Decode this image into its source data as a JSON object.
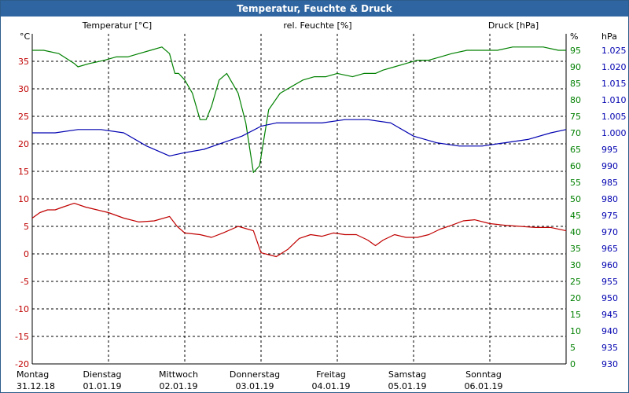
{
  "window": {
    "title": "Temperatur, Feuchte & Druck"
  },
  "colors": {
    "temperature": "#c00000",
    "humidity": "#008000",
    "pressure": "#0000b0",
    "grid": "#000000",
    "titlebar": "#2f65a0"
  },
  "chart_data": {
    "type": "line",
    "title": "Temperatur, Feuchte & Druck",
    "series_labels": {
      "temperature": "Temperatur [°C]",
      "humidity": "rel. Feuchte [%]",
      "pressure": "Druck [hPa]"
    },
    "units": {
      "temperature": "°C",
      "humidity": "%",
      "pressure": "hPa"
    },
    "x_labels": [
      {
        "day": "Montag",
        "date": "31.12.18"
      },
      {
        "day": "Dienstag",
        "date": "01.01.19"
      },
      {
        "day": "Mittwoch",
        "date": "02.01.19"
      },
      {
        "day": "Donnerstag",
        "date": "03.01.19"
      },
      {
        "day": "Freitag",
        "date": "04.01.19"
      },
      {
        "day": "Samstag",
        "date": "05.01.19"
      },
      {
        "day": "Sonntag",
        "date": "06.01.19"
      }
    ],
    "xlim": [
      0,
      7
    ],
    "axes": {
      "temperature": {
        "lim": [
          -20,
          40
        ],
        "ticks": [
          -20,
          -15,
          -10,
          -5,
          0,
          5,
          10,
          15,
          20,
          25,
          30,
          35
        ]
      },
      "humidity": {
        "lim": [
          0,
          100
        ],
        "ticks": [
          0,
          5,
          10,
          15,
          20,
          25,
          30,
          35,
          40,
          45,
          50,
          55,
          60,
          65,
          70,
          75,
          80,
          85,
          90,
          95
        ]
      },
      "pressure": {
        "lim": [
          930,
          1030
        ],
        "ticks": [
          930,
          935,
          940,
          945,
          950,
          955,
          960,
          965,
          970,
          975,
          980,
          985,
          990,
          995,
          1000,
          1005,
          1010,
          1015,
          1020,
          1025
        ]
      }
    },
    "grid": true,
    "series": [
      {
        "name": "Temperatur [°C]",
        "axis": "temperature",
        "x": [
          0,
          0.1,
          0.2,
          0.3,
          0.4,
          0.55,
          0.7,
          0.85,
          1.0,
          1.2,
          1.4,
          1.6,
          1.8,
          1.9,
          2.0,
          2.2,
          2.35,
          2.5,
          2.7,
          2.9,
          3.0,
          3.2,
          3.35,
          3.5,
          3.65,
          3.8,
          3.95,
          4.1,
          4.25,
          4.4,
          4.5,
          4.6,
          4.75,
          4.9,
          5.05,
          5.2,
          5.35,
          5.5,
          5.65,
          5.8,
          6.0,
          6.2,
          6.4,
          6.6,
          6.8,
          7.0
        ],
        "values": [
          6.5,
          7.5,
          8.0,
          8.0,
          8.5,
          9.2,
          8.5,
          8.0,
          7.5,
          6.5,
          5.8,
          6.0,
          6.8,
          5.0,
          3.8,
          3.5,
          3.0,
          3.8,
          5.0,
          4.2,
          0.2,
          -0.5,
          0.8,
          2.8,
          3.5,
          3.2,
          3.8,
          3.5,
          3.5,
          2.5,
          1.5,
          2.5,
          3.5,
          3.0,
          3.0,
          3.5,
          4.5,
          5.2,
          6.0,
          6.2,
          5.5,
          5.2,
          5.0,
          4.8,
          4.8,
          4.2
        ]
      },
      {
        "name": "rel. Feuchte [%]",
        "axis": "humidity",
        "x": [
          0,
          0.15,
          0.35,
          0.55,
          0.6,
          0.75,
          0.95,
          1.1,
          1.25,
          1.4,
          1.55,
          1.7,
          1.8,
          1.87,
          1.92,
          2.0,
          2.1,
          2.2,
          2.28,
          2.35,
          2.45,
          2.55,
          2.7,
          2.8,
          2.9,
          2.98,
          3.1,
          3.25,
          3.4,
          3.55,
          3.7,
          3.85,
          4.0,
          4.2,
          4.35,
          4.5,
          4.6,
          4.75,
          4.9,
          5.05,
          5.2,
          5.35,
          5.5,
          5.7,
          5.9,
          6.1,
          6.3,
          6.5,
          6.7,
          6.9,
          7.0
        ],
        "values": [
          95,
          95,
          94,
          91,
          90,
          91,
          92,
          93,
          93,
          94,
          95,
          96,
          94,
          88,
          88,
          86,
          82,
          74,
          74,
          78,
          86,
          88,
          82,
          73,
          58,
          60,
          77,
          82,
          84,
          86,
          87,
          87,
          88,
          87,
          88,
          88,
          89,
          90,
          91,
          92,
          92,
          93,
          94,
          95,
          95,
          95,
          96,
          96,
          96,
          95,
          95
        ]
      },
      {
        "name": "Druck [hPa]",
        "axis": "pressure",
        "x": [
          0,
          0.3,
          0.6,
          0.9,
          1.2,
          1.5,
          1.8,
          2.0,
          2.25,
          2.5,
          2.75,
          3.0,
          3.2,
          3.5,
          3.8,
          4.1,
          4.4,
          4.7,
          5.0,
          5.3,
          5.6,
          5.9,
          6.2,
          6.5,
          6.8,
          7.0
        ],
        "values": [
          1000,
          1000,
          1001,
          1001,
          1000,
          996,
          993,
          994,
          995,
          997,
          999,
          1002,
          1003,
          1003,
          1003,
          1004,
          1004,
          1003,
          999,
          997,
          996,
          996,
          997,
          998,
          1000,
          1001
        ]
      }
    ]
  }
}
